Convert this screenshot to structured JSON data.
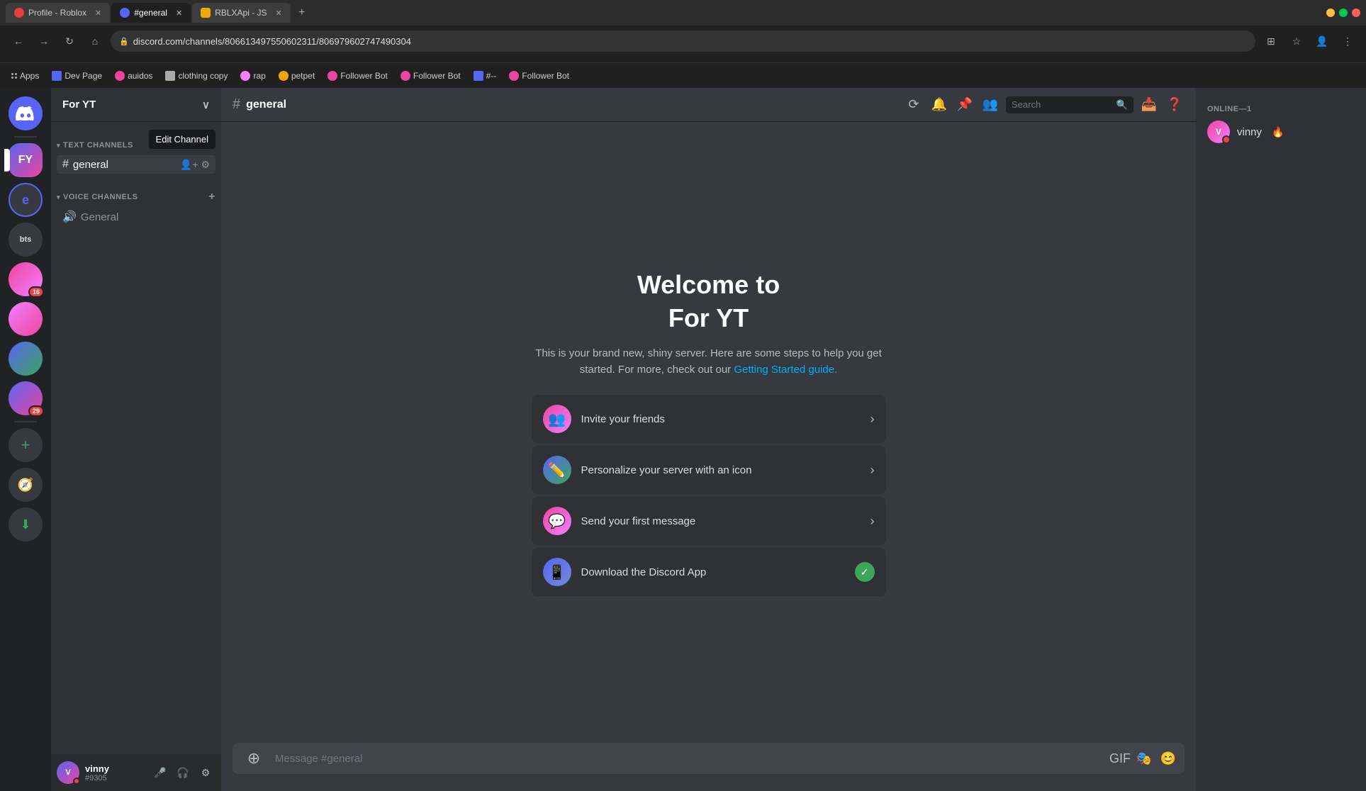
{
  "browser": {
    "tabs": [
      {
        "id": "tab1",
        "label": "Profile - Roblox",
        "favicon_color": "#e53e3e",
        "active": false
      },
      {
        "id": "tab2",
        "label": "#general",
        "favicon_color": "#5865f2",
        "active": true
      },
      {
        "id": "tab3",
        "label": "RBLXApi - JS",
        "favicon_color": "#f0a500",
        "active": false
      }
    ],
    "address": "discord.com/channels/806613497550602311/806979602747490304",
    "new_tab": "+"
  },
  "bookmarks": [
    {
      "label": "Apps",
      "has_grid_icon": true
    },
    {
      "label": "Dev Page"
    },
    {
      "label": "auidos"
    },
    {
      "label": "clothing copy"
    },
    {
      "label": "rap"
    },
    {
      "label": "petpet"
    },
    {
      "label": "Follower Bot"
    },
    {
      "label": "Follower Bot"
    },
    {
      "label": "#--"
    },
    {
      "label": "Follower Bot"
    }
  ],
  "discord": {
    "servers": [
      {
        "id": "fy",
        "label": "FY",
        "initials": "FY",
        "active": true
      },
      {
        "id": "e",
        "label": "e",
        "initials": "e"
      },
      {
        "id": "bts",
        "label": "bts",
        "initials": "bts"
      },
      {
        "id": "srv4",
        "label": "",
        "has_notif": "16",
        "color": "#5865f2"
      },
      {
        "id": "srv5",
        "label": "",
        "has_notif": "",
        "color": "#eb459e"
      },
      {
        "id": "srv6",
        "label": "",
        "has_notif": "",
        "color": "#3ba55c"
      },
      {
        "id": "srv7",
        "label": "",
        "has_notif": "29",
        "color": "#5865f2"
      }
    ],
    "sidebar": {
      "server_name": "For YT",
      "text_channels_label": "TEXT CHANNELS",
      "voice_channels_label": "VOICE CHANNELS",
      "channels": [
        {
          "id": "general",
          "name": "general",
          "type": "text",
          "active": true
        },
        {
          "id": "general-voice",
          "name": "General",
          "type": "voice"
        }
      ]
    },
    "channel_header": {
      "name": "general",
      "icon": "#"
    },
    "welcome": {
      "title_line1": "Welcome to",
      "title_line2": "For YT",
      "description": "This is your brand new, shiny server. Here are some steps to help you get started. For more, check out our",
      "getting_started_link": "Getting Started guide.",
      "actions": [
        {
          "id": "invite",
          "label": "Invite your friends",
          "icon_color": "#eb459e",
          "icon": "👥",
          "has_check": false
        },
        {
          "id": "personalize",
          "label": "Personalize your server with an icon",
          "icon_color": "#5865f2",
          "icon": "✏️",
          "has_check": false
        },
        {
          "id": "first-message",
          "label": "Send your first message",
          "icon_color": "#f47fff",
          "icon": "💬",
          "has_check": false
        },
        {
          "id": "download",
          "label": "Download the Discord App",
          "icon_color": "#5865f2",
          "icon": "📱",
          "has_check": true
        }
      ]
    },
    "message_input": {
      "placeholder": "Message #general"
    },
    "right_sidebar": {
      "online_header": "ONLINE—1",
      "members": [
        {
          "name": "vinny",
          "tag": "",
          "has_badge": "🔥",
          "status": "dnd"
        }
      ]
    },
    "user": {
      "name": "vinny",
      "tag": "#9305",
      "status": "dnd"
    },
    "edit_channel_tooltip": "Edit Channel",
    "search_placeholder": "Search"
  }
}
